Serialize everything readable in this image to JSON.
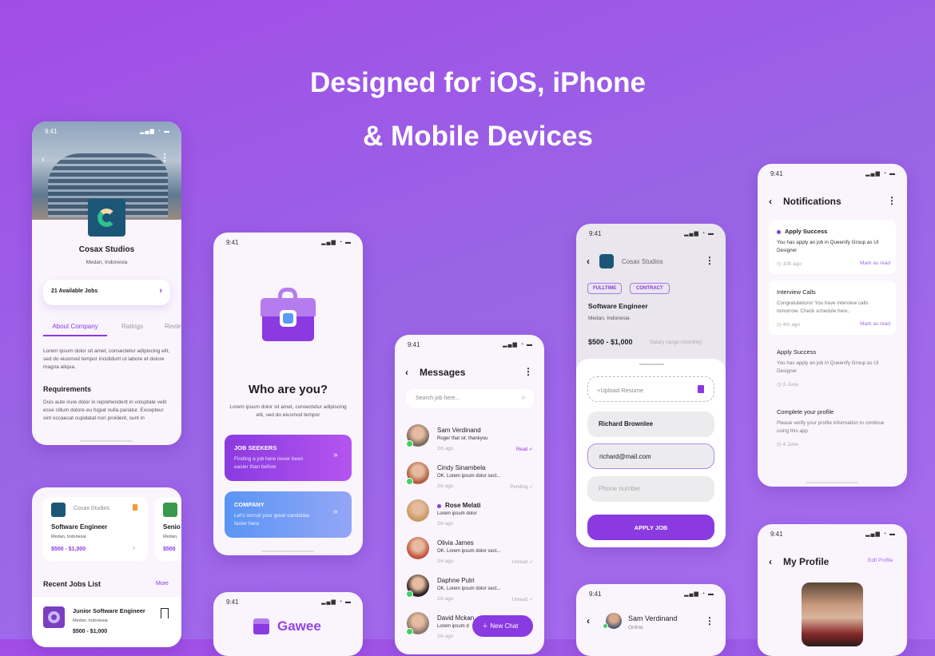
{
  "hero": {
    "line1": "Designed for iOS, iPhone",
    "line2": "& Mobile Devices"
  },
  "status_time": "9:41",
  "colors": {
    "accent": "#8a3ae0",
    "online": "#3fd163",
    "bookmark": "#f59a3c"
  },
  "company": {
    "name": "Cosax Studios",
    "location": "Medan, Indonesia",
    "jobs_button": "21 Available Jobs",
    "tabs": [
      "About Company",
      "Ratings",
      "Reviews"
    ],
    "about": "Lorem ipsum dolor sit amet, consectetur adipiscing elit, sed do eiusmod tempor incididunt ut labore et dolore magna aliqua.",
    "req_title": "Requirements",
    "req_text": "Duis aute irure dolor in reprehenderit in voluptate velit esse cillum dolore eu fugiat nulla pariatur. Excepteur sint occaecat cupidatat non proident, sunt in"
  },
  "home": {
    "card": {
      "company": "Cosax Studios",
      "title": "Software Engineer",
      "location": "Medan, Indonesia",
      "salary": "$500 - $1,000"
    },
    "card2": {
      "title": "Senio",
      "location": "Medan,",
      "salary": "$500"
    },
    "recent_title": "Recent Jobs List",
    "more": "More",
    "recent": {
      "title": "Junior Software Engineer",
      "location": "Medan, Indonesia",
      "salary": "$500 - $1,000"
    }
  },
  "role": {
    "title": "Who are you?",
    "desc": "Lorem ipsum dolor sit amet, consectetur adipiscing elit, sed do eiusmod tempor",
    "seeker_title": "JOB SEEKERS",
    "seeker_desc": "Finding a job here never been easier than before",
    "company_title": "COMPANY",
    "company_desc": "Let's recruit your great candidate faster here"
  },
  "splash": {
    "brand": "Gawee"
  },
  "messages": {
    "title": "Messages",
    "search_placeholder": "Search job here...",
    "new_chat": "New Chat",
    "items": [
      {
        "name": "Sam Verdinand",
        "text": "Roger that sir, thankyou",
        "time": "2m ago",
        "status": "Read"
      },
      {
        "name": "Cindy Sinambela",
        "text": "OK. Lorem ipsum dolor sect...",
        "time": "2m ago",
        "status": "Pending"
      },
      {
        "name": "Rose Melati",
        "text": "Lorem ipsum dolor",
        "time": "2m ago",
        "status": ""
      },
      {
        "name": "Olivia James",
        "text": "OK. Lorem ipsum dolor sect...",
        "time": "2m ago",
        "status": "Unread"
      },
      {
        "name": "Daphne Putri",
        "text": "OK. Lorem ipsum dolor sect...",
        "time": "2m ago",
        "status": "Unread"
      },
      {
        "name": "David Mckan",
        "text": "Lorem ipsum d",
        "time": "2m ago",
        "status": ""
      }
    ]
  },
  "apply": {
    "company": "Cosax Studios",
    "tags": [
      "FULLTIME",
      "CONTRACT"
    ],
    "title": "Software Engineer",
    "location": "Medan, Indonesia",
    "salary": "$500 - $1,000",
    "salary_label": "Salary range (monthly)",
    "upload": "+Upload Resume",
    "name_value": "Richard Brownlee",
    "email_value": "richard@mail.com",
    "phone_placeholder": "Phone number",
    "submit": "APPLY JOB"
  },
  "chat": {
    "name": "Sam Verdinand",
    "status": "Online"
  },
  "notifications": {
    "title": "Notifications",
    "items": [
      {
        "title": "Apply Success",
        "text": "You has apply an job in Queenify Group as UI Designer",
        "time": "10h ago",
        "action": "Mark as read"
      },
      {
        "title": "Interview Calls",
        "text": "Congratulations! You have interview calls tomorrow. Check schedule here..",
        "time": "4m ago",
        "action": "Mark as read"
      },
      {
        "title": "Apply Success",
        "text": "You has apply an job in Queenify Group as UI Designer",
        "time": "3 June",
        "action": ""
      },
      {
        "title": "Complete your profile",
        "text": "Please verify your profile information to continue using this app",
        "time": "4 June",
        "action": ""
      }
    ]
  },
  "profile": {
    "title": "My Profile",
    "edit": "Edit Profile"
  }
}
